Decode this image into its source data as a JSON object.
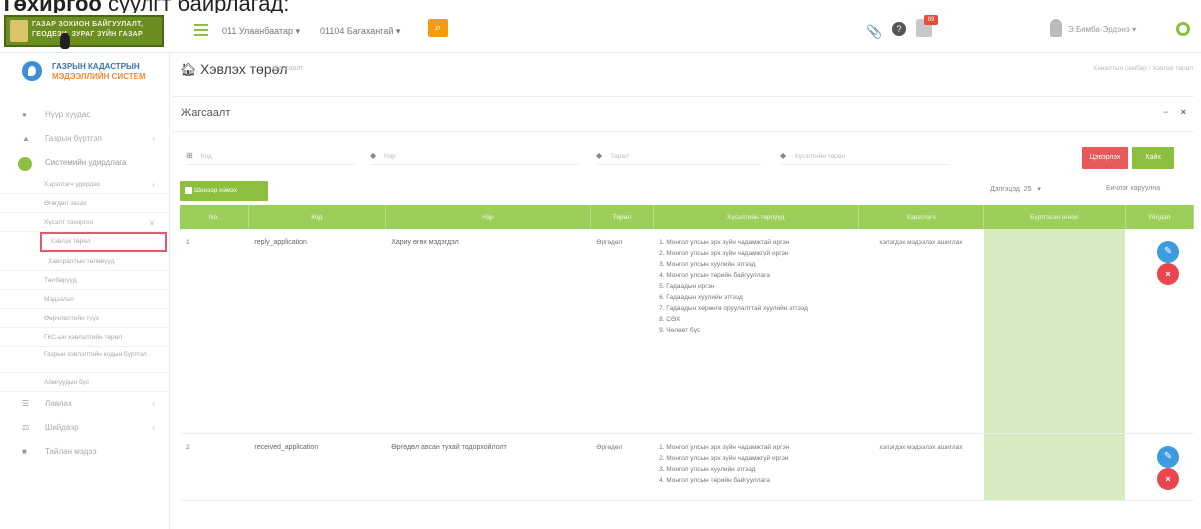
{
  "caption": {
    "bold": "Төхиргоо",
    "rest": " суулгт байрлагад:"
  },
  "topbar": {
    "logo_line1": "ГАЗАР ЗОХИОН БАЙГУУЛАЛТ,",
    "logo_line2": "ГЕОДЕЗИ, ЗУРАГ ЗҮЙН ГАЗАР",
    "city_select": "011 Улаанбаатар",
    "district_select": "01104 Багахангай",
    "search_icon": "search-icon",
    "user_name": "Э.Бямба-Эрдэнэ",
    "notification_count": "89"
  },
  "sidebar": {
    "brand_line1": "ГАЗРЫН КАДАСТРЫН",
    "brand_line2": "МЭДЭЭЛЛИЙН СИСТЕМ",
    "items": [
      {
        "label": "Нүүр хуудас",
        "icon": "home-icon"
      },
      {
        "label": "Газрын бүртгэл",
        "icon": "user-icon",
        "chevron": "‹"
      },
      {
        "label": "Системийн удирдлага",
        "icon": "cog-icon"
      }
    ],
    "sub_items": [
      {
        "label": "Хэрэглэгч удирдах",
        "chevron": "‹"
      },
      {
        "label": "Өгөгдөл засах"
      },
      {
        "label": "Хүсэлт тохиргоо",
        "chevron": "‹"
      },
      {
        "label": "Хэвлэх төрөл"
      },
      {
        "label": "Хавсралтын төлөвүүд"
      },
      {
        "label": "Төлбөрүүд"
      },
      {
        "label": "Мэдээлэл"
      },
      {
        "label": "Өөрчлөлтийн түүх"
      },
      {
        "label": "ГКС-ын хэвлэлтийн төрөл"
      },
      {
        "label": "Газрын хэвлэлтийн кодын бүртгэл"
      },
      {
        "label": "Аймгуудын бүс"
      }
    ],
    "bottom_items": [
      {
        "label": "Лавлах",
        "chevron": "‹"
      },
      {
        "label": "Шийдвэр",
        "chevron": "‹"
      },
      {
        "label": "Тайлан мэдээ"
      }
    ]
  },
  "page": {
    "title": "Хэвлэх төрөл",
    "subtitle": "Жагсаалт",
    "breadcrumb": "Хяналтын самбар / Хэвлэх төрөл"
  },
  "panel": {
    "title": "Жагсаалт",
    "minimize": "−",
    "close": "×"
  },
  "filters": {
    "code_placeholder": "Код",
    "name_placeholder": "Нэр",
    "type_placeholder": "Төрөл",
    "category_placeholder": "Хүсэлтийн төрөл",
    "clear_label": "Цэвэрлэх",
    "search_label": "Хайх"
  },
  "toolbar": {
    "new_label": "Шинээр нэмэх",
    "page_size_label": "Дэлгэцэд",
    "page_size_value": "25",
    "print_label": "Бичлэг харуулна"
  },
  "table": {
    "columns": [
      "No.",
      "Код",
      "Нэр",
      "Төрөл",
      "Хүсэлтийн төрлүүд",
      "Хэрэглэгч",
      "Бүртгэсэн огноо",
      "Үйлдэл"
    ],
    "rows": [
      {
        "no": "1",
        "code": "reply_application",
        "name": "Хариу өгөх мэдэгдэл",
        "type": "Өргөдөл",
        "req_types": "1. Монгол улсын эрх зүйн чадамжтай иргэн\n2. Монгол улсын эрх зүйн чадамжгүй иргэн\n3. Монгол улсын хуулийн этгээд\n4. Монгол улсын төрийн байгууллага\n5. Гадаадын иргэн\n6. Гадаадын хуулийн этгээд\n7. Гадаадын хөрөнгө оруулалттай хуулийн этгээд\n8. СӨХ\n9. Чөлөөт бүс",
        "user": "хэлэгдэх мэдээлэх ашиглах",
        "date": ""
      },
      {
        "no": "2",
        "code": "received_application",
        "name": "Өргөдөл авсан тухай тодорхойлолт",
        "type": "Өргөдөл",
        "req_types": "1. Монгол улсын эрх зүйн чадамжтай иргэн\n2. Монгол улсын эрх зүйн чадамжгүй иргэн\n3. Монгол улсын хуулийн этгээд\n4. Монгол улсын төрийн байгууллага",
        "user": "хэлэгдэх мэдээлэх ашиглах",
        "date": ""
      }
    ]
  },
  "colors": {
    "accent": "#8cbf3f",
    "table_header": "#9ccf5a",
    "danger": "#e85a5a",
    "edit": "#3d9be0",
    "highlight_border": "#e05a6e"
  }
}
